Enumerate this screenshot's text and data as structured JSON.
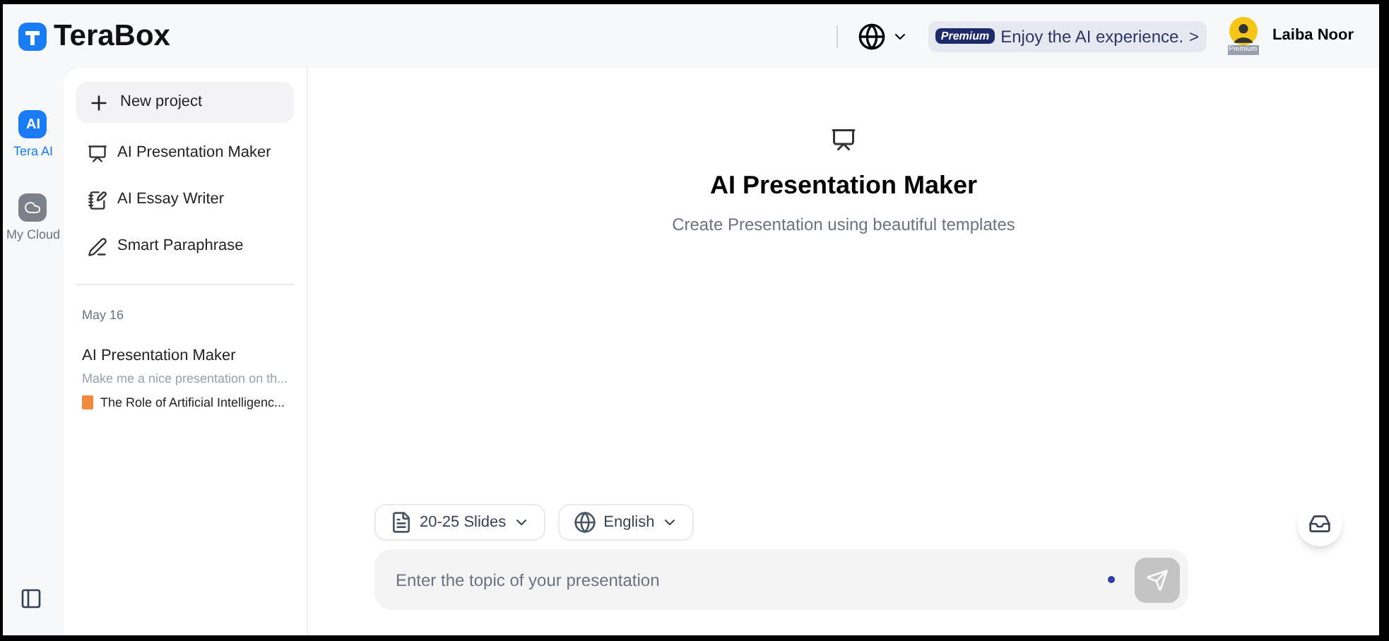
{
  "header": {
    "logo": "TeraBox",
    "premium_badge": "Premium",
    "promo": "Enjoy the AI experience.",
    "promo_arrow": ">",
    "avatar_badge": "Premium",
    "user_name": "Laiba Noor"
  },
  "rail": [
    {
      "kind": "ai",
      "label": "Tera AI",
      "icon": "AI",
      "selected": true
    },
    {
      "kind": "cloud",
      "label": "My Cloud",
      "selected": false
    }
  ],
  "sidebar": {
    "new_project": "New project",
    "tools": [
      {
        "kind": "presentation",
        "label": "AI Presentation Maker"
      },
      {
        "kind": "essay",
        "label": "AI Essay Writer"
      },
      {
        "kind": "paraphrase",
        "label": "Smart Paraphrase"
      }
    ],
    "history": [
      {
        "date": "May 16",
        "items": [
          {
            "title": "AI Presentation Maker",
            "subtitle": "Make me a nice presentation on th...",
            "file": "The Role of Artificial Intelligenc..."
          }
        ]
      }
    ]
  },
  "main": {
    "title": "AI Presentation Maker",
    "subtitle": "Create Presentation using beautiful templates",
    "options": [
      {
        "kind": "slides",
        "label": "20-25 Slides"
      },
      {
        "kind": "language",
        "label": "English"
      }
    ],
    "input": {
      "placeholder": "Enter the topic of your presentation"
    }
  }
}
